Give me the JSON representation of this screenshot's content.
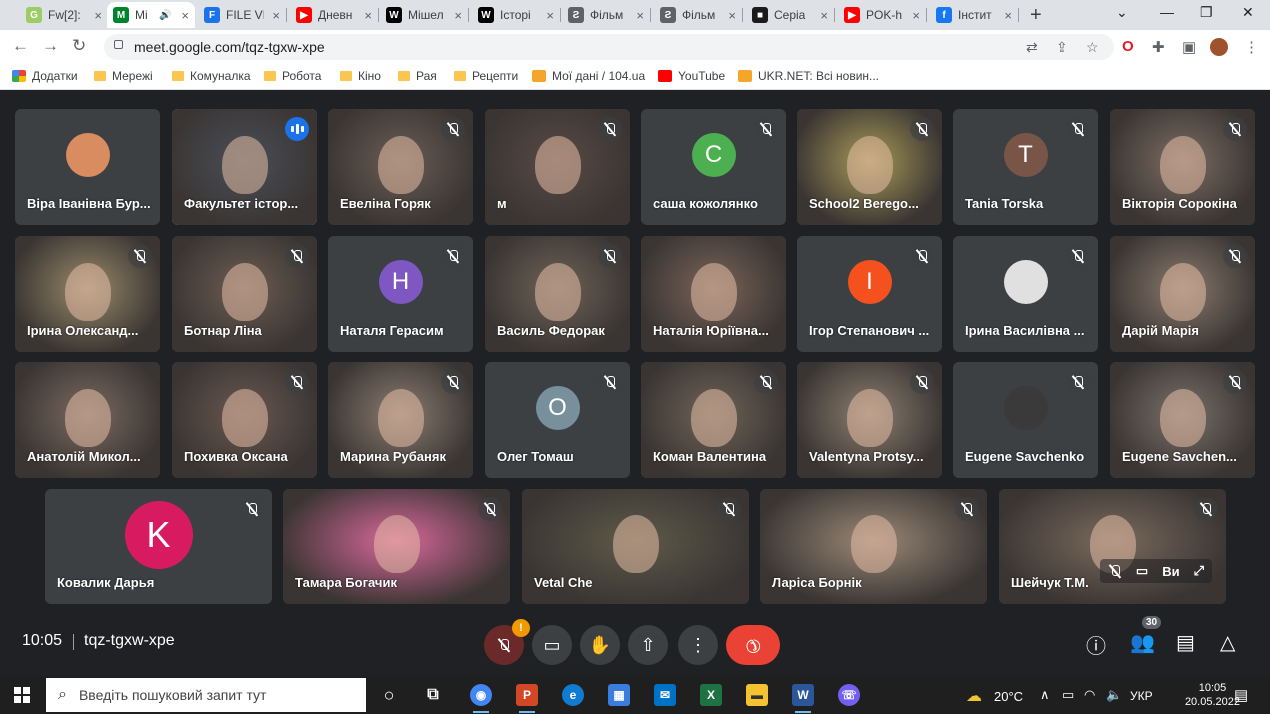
{
  "browser": {
    "tabs": [
      {
        "title": "Fw[2]:",
        "favicon_color": "#9ccc65"
      },
      {
        "title": "Mi",
        "favicon_color": "#00832d",
        "active": true
      },
      {
        "title": "FILE VI",
        "favicon_color": "#1a73e8"
      },
      {
        "title": "Дневн",
        "favicon_color": "#ff0000"
      },
      {
        "title": "Мішел",
        "favicon_color": "#000000"
      },
      {
        "title": "Історі",
        "favicon_color": "#000000"
      },
      {
        "title": "Фільм",
        "favicon_color": "#5f6368"
      },
      {
        "title": "Фільм",
        "favicon_color": "#5f6368"
      },
      {
        "title": "Серіа",
        "favicon_color": "#1b1b1b"
      },
      {
        "title": "POK-h",
        "favicon_color": "#ff0000"
      },
      {
        "title": "Інстит",
        "favicon_color": "#1877f2"
      }
    ],
    "tab_favicon_glyphs": [
      "G",
      "M",
      "F",
      "▶",
      "W",
      "W",
      "Ƨ",
      "Ƨ",
      "■",
      "▶",
      "f"
    ],
    "url": "meet.google.com/tqz-tgxw-xpe",
    "bookmarks": [
      {
        "label": "Додатки",
        "type": "apps"
      },
      {
        "label": "Мережі",
        "type": "folder"
      },
      {
        "label": "Комуналка",
        "type": "folder"
      },
      {
        "label": "Робота",
        "type": "folder"
      },
      {
        "label": "Кіно",
        "type": "folder"
      },
      {
        "label": "Рая",
        "type": "folder"
      },
      {
        "label": "Рецепти",
        "type": "folder"
      },
      {
        "label": "Мої дані / 104.ua",
        "type": "site"
      },
      {
        "label": "YouTube",
        "type": "youtube"
      },
      {
        "label": "UKR.NET: Всі новин...",
        "type": "site"
      }
    ]
  },
  "participants": [
    {
      "name": "Віра Іванівна Бур...",
      "muted": false,
      "avatar": "photo",
      "bg": "#3c4043",
      "avatar_color": "#d98c5f"
    },
    {
      "name": "Факультет істор...",
      "muted": false,
      "speaking": true,
      "video": "#4a4f58"
    },
    {
      "name": "Евеліна Горяк",
      "muted": true,
      "video": "#6b5d55"
    },
    {
      "name": "м",
      "muted": true,
      "video": "#5a4a45"
    },
    {
      "name": "саша кожолянко",
      "muted": true,
      "avatar": "С",
      "avatar_color": "#4caf50"
    },
    {
      "name": "School2 Berego...",
      "muted": true,
      "video": "#a89a58"
    },
    {
      "name": "Tania Torska",
      "muted": true,
      "avatar": "T",
      "avatar_color": "#795548"
    },
    {
      "name": "Вікторія Сорокіна",
      "muted": true,
      "video": "#7d6d62"
    },
    {
      "name": "Ірина Олександ...",
      "muted": true,
      "video": "#9a8a6a"
    },
    {
      "name": "Ботнар Ліна",
      "muted": true,
      "video": "#6d5d52"
    },
    {
      "name": "Наталя Герасим",
      "muted": true,
      "avatar": "Н",
      "avatar_color": "#7e57c2"
    },
    {
      "name": "Василь Федорак",
      "muted": true,
      "video": "#6e6256"
    },
    {
      "name": "Наталія Юріївна...",
      "muted": false,
      "video": "#7a6458"
    },
    {
      "name": "Ігор Степанович ...",
      "muted": true,
      "avatar": "І",
      "avatar_color": "#f4511e"
    },
    {
      "name": "Ірина Василівна ...",
      "muted": true,
      "avatar": "photo",
      "avatar_color": "#e0e0e0"
    },
    {
      "name": "Дарій Марія",
      "muted": true,
      "video": "#8a7a6c"
    },
    {
      "name": "Анатолій Микол...",
      "muted": false,
      "video": "#7b6a60"
    },
    {
      "name": "Похивка Оксана",
      "muted": true,
      "video": "#6a5850"
    },
    {
      "name": "Марина Рубаняк",
      "muted": true,
      "video": "#8c7d70"
    },
    {
      "name": "Олег Томаш",
      "muted": true,
      "avatar": "O",
      "avatar_color": "#78909c"
    },
    {
      "name": "Коман Валентина",
      "muted": true,
      "video": "#6f6457"
    },
    {
      "name": "Valentyna Protsy...",
      "muted": true,
      "video": "#8d7f70"
    },
    {
      "name": "Eugene Savchenko",
      "muted": true,
      "avatar": "photo",
      "avatar_color": "#3a3a3a"
    },
    {
      "name": "Eugene Savchen...",
      "muted": true,
      "video": "#7a7068"
    },
    {
      "name": "Ковалик Дарья",
      "muted": true,
      "avatar": "K",
      "avatar_color": "#d81b60",
      "big": true
    },
    {
      "name": "Тамара Богачик",
      "muted": true,
      "video": "#d9689a"
    },
    {
      "name": "Vetal Che",
      "muted": true,
      "video": "#5e5a48"
    },
    {
      "name": "Ларіса Борнік",
      "muted": true,
      "video": "#9a8876"
    },
    {
      "name": "Шейчук Т.М.",
      "muted": true,
      "video": "#7a6a5c",
      "self": true
    }
  ],
  "self_overlay": {
    "label": "Ви"
  },
  "meeting": {
    "time": "10:05",
    "code": "tqz-tgxw-xpe",
    "participant_count": "30",
    "mic_alert": "!"
  },
  "taskbar": {
    "search_placeholder": "Введіть пошуковий запит тут",
    "temperature": "20°C",
    "language": "УКР",
    "time": "10:05",
    "date": "20.05.2022"
  }
}
